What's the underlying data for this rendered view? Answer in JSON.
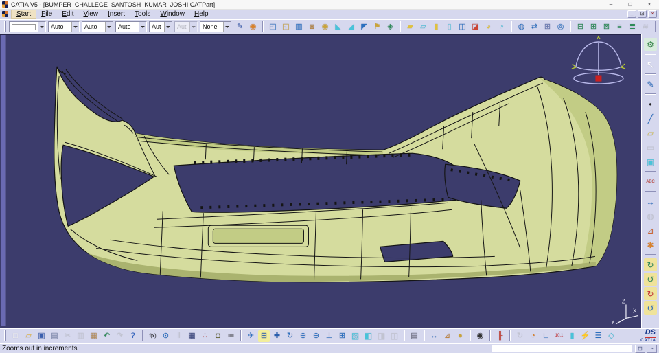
{
  "colors": {
    "vp-bg": "#3c3c6c",
    "model": "#d5dc9e",
    "model-dark": "#c2cc85",
    "model-darker": "#aab36f",
    "edge": "#151515",
    "strip": "#6a6ab2",
    "compass": "#b9b9ea",
    "ui": "#d6d8ee",
    "accent": "#2a6fbf"
  },
  "title_bar": {
    "title": "CATIA V5 - [BUMPER_CHALLEGE_SANTOSH_KUMAR_JOSHI.CATPart]",
    "controls": [
      {
        "name": "minimize-button",
        "glyph": "–",
        "color": "#333"
      },
      {
        "name": "maximize-button",
        "glyph": "□",
        "color": "#333"
      },
      {
        "name": "close-button",
        "glyph": "×",
        "color": "#333"
      }
    ]
  },
  "menu_bar": {
    "items": [
      "Start",
      "File",
      "Edit",
      "View",
      "Insert",
      "Tools",
      "Window",
      "Help"
    ],
    "controls": [
      {
        "name": "mdi-minimize-button",
        "glyph": "_",
        "color": "#333"
      },
      {
        "name": "mdi-restore-button",
        "glyph": "⊡",
        "color": "#333"
      },
      {
        "name": "mdi-close-button",
        "glyph": "×",
        "color": "#a03030"
      }
    ]
  },
  "top_toolbar": {
    "combos": [
      {
        "name": "layer-combo",
        "swatch": true,
        "w": 54
      },
      {
        "name": "color-combo",
        "value": "Auto",
        "w": 46
      },
      {
        "name": "linetype-combo",
        "value": "Auto",
        "w": 46
      },
      {
        "name": "thickness-combo",
        "value": "Auto",
        "w": 46
      },
      {
        "name": "symbol-combo",
        "value": "Aut",
        "w": 34
      },
      {
        "name": "render-combo",
        "value": "Aut",
        "w": 34,
        "disabled": true
      },
      {
        "name": "layer-filter-combo",
        "value": "None",
        "w": 46
      }
    ],
    "icons": [
      {
        "name": "painter-icon",
        "glyph": "✎",
        "color": "#3a5fae"
      },
      {
        "name": "graphic-wizard-icon",
        "glyph": "◉",
        "color": "#d9822b"
      },
      {
        "sep": true
      },
      {
        "name": "open-body-icon",
        "glyph": "◰",
        "color": "#2a6fbf"
      },
      {
        "name": "insert-body-icon",
        "glyph": "◱",
        "color": "#caa43a"
      },
      {
        "name": "translate-icon",
        "glyph": "▥",
        "color": "#2a6fbf"
      },
      {
        "name": "rotate-body-icon",
        "glyph": "◙",
        "color": "#b5884a"
      },
      {
        "name": "symmetry-icon",
        "glyph": "◉",
        "color": "#caa43a"
      },
      {
        "name": "scaling-icon",
        "glyph": "◣",
        "color": "#49c3d9"
      },
      {
        "name": "mirror-icon",
        "glyph": "◢",
        "color": "#49c3d9"
      },
      {
        "name": "pattern-icon",
        "glyph": "◤",
        "color": "#2a6fbf"
      },
      {
        "name": "flag-note-icon",
        "glyph": "⚑",
        "color": "#caa43a"
      },
      {
        "name": "thick-surface-icon",
        "glyph": "◈",
        "color": "#2e8b57"
      },
      {
        "sep": true
      },
      {
        "name": "pad-icon",
        "glyph": "▰",
        "color": "#e0c23e"
      },
      {
        "name": "pocket-icon",
        "glyph": "▱",
        "color": "#49c3d9"
      },
      {
        "name": "shaft-icon",
        "glyph": "▮",
        "color": "#e0c23e"
      },
      {
        "name": "groove-icon",
        "glyph": "▯",
        "color": "#49c3d9"
      },
      {
        "name": "hole-icon",
        "glyph": "◫",
        "color": "#2a6fbf"
      },
      {
        "name": "rib-icon",
        "glyph": "◪",
        "color": "#cc4433"
      },
      {
        "name": "slot-icon",
        "glyph": "◕",
        "color": "#e0c23e"
      },
      {
        "name": "stiffener-icon",
        "glyph": "◔",
        "color": "#49c3d9"
      },
      {
        "sep": true
      },
      {
        "name": "sew-surface-icon",
        "glyph": "◍",
        "color": "#2a6fbf"
      },
      {
        "name": "split-icon",
        "glyph": "⇄",
        "color": "#2a6fbf"
      },
      {
        "name": "work-grid-icon",
        "glyph": "⊞",
        "color": "#6a7ab0"
      },
      {
        "name": "light-source-icon",
        "glyph": "◎",
        "color": "#2a6fbf"
      },
      {
        "sep": true
      },
      {
        "name": "constraint-icon",
        "glyph": "⊟",
        "color": "#2e8b57"
      },
      {
        "name": "contact-constraint-icon",
        "glyph": "⊞",
        "color": "#2e8b57"
      },
      {
        "name": "fix-constraint-icon",
        "glyph": "⊠",
        "color": "#2e8b57"
      },
      {
        "name": "coincidence-icon",
        "glyph": "≡",
        "color": "#2e8b57"
      },
      {
        "name": "offset-constraint-icon",
        "glyph": "≣",
        "color": "#2e8b57"
      },
      {
        "name": "auto-constraint-icon",
        "glyph": "≋",
        "color": "#9aa",
        "disabled": true
      },
      {
        "sep": true
      },
      {
        "name": "eraser-icon",
        "glyph": "◆",
        "color": "#49a9d9"
      }
    ]
  },
  "right_toolbar": {
    "icons": [
      {
        "name": "workbench-icon",
        "glyph": "⚙",
        "color": "#3f8f4f",
        "bg": "#d9ecdd"
      },
      {
        "sep": true
      },
      {
        "name": "select-icon",
        "glyph": "↖",
        "color": "#ffffff",
        "fs": 14
      },
      {
        "sep": true
      },
      {
        "name": "sketcher-icon",
        "glyph": "✎",
        "color": "#2a6fbf"
      },
      {
        "sep": true
      },
      {
        "name": "point-icon",
        "glyph": "•",
        "color": "#222"
      },
      {
        "name": "line-icon",
        "glyph": "╱",
        "color": "#2a6fbf"
      },
      {
        "name": "plane-icon",
        "glyph": "▱",
        "color": "#d8c23a"
      },
      {
        "name": "positioned-sketch-icon",
        "glyph": "▭",
        "color": "#9aa",
        "disabled": true
      },
      {
        "name": "bounding-box-icon",
        "glyph": "▣",
        "color": "#49c3d9"
      },
      {
        "sep": true
      },
      {
        "name": "annotation-icon",
        "glyph": "ABC",
        "color": "#c0392b",
        "fs": 6
      },
      {
        "sep": true
      },
      {
        "name": "measure-icon",
        "glyph": "↔",
        "color": "#2a6fbf"
      },
      {
        "name": "apply-material-icon",
        "glyph": "◍",
        "color": "#9aa",
        "disabled": true
      },
      {
        "name": "measure-item-icon",
        "glyph": "⊿",
        "color": "#cc6633"
      },
      {
        "name": "graphic-properties-icon",
        "glyph": "✱",
        "color": "#d9822b"
      },
      {
        "sep": true
      },
      {
        "name": "catalog-browser-icon",
        "glyph": "↻",
        "color": "#2e8b57",
        "bg": "#efe39a"
      },
      {
        "name": "catalog-update-icon",
        "glyph": "↺",
        "color": "#2e8b57",
        "bg": "#efe39a"
      },
      {
        "name": "catalog-sync-icon",
        "glyph": "↻",
        "color": "#cc3333",
        "bg": "#efe39a"
      },
      {
        "name": "catalog-instantiate-icon",
        "glyph": "↺",
        "color": "#2a6fbf",
        "bg": "#efe39a"
      }
    ]
  },
  "bottom_toolbar": {
    "icons": [
      {
        "name": "new-document-icon",
        "glyph": "□",
        "color": "#fffef2"
      },
      {
        "name": "open-icon",
        "glyph": "▱",
        "color": "#e8b93e"
      },
      {
        "name": "save-icon",
        "glyph": "▣",
        "color": "#3a5fae"
      },
      {
        "name": "print-icon",
        "glyph": "▤",
        "color": "#7a86a8"
      },
      {
        "name": "cut-icon",
        "glyph": "✂",
        "color": "#9aa",
        "disabled": true
      },
      {
        "name": "copy-icon",
        "glyph": "▥",
        "color": "#9aa",
        "disabled": true
      },
      {
        "name": "paste-icon",
        "glyph": "▦",
        "color": "#b5884a"
      },
      {
        "name": "undo-icon",
        "glyph": "↶",
        "color": "#2e8b57"
      },
      {
        "name": "redo-icon",
        "glyph": "↷",
        "color": "#9aa",
        "disabled": true
      },
      {
        "name": "whats-this-icon",
        "glyph": "?",
        "color": "#2a5fbf"
      },
      {
        "sep": true
      },
      {
        "name": "formula-icon",
        "glyph": "f(x)",
        "color": "#222",
        "fs": 7
      },
      {
        "name": "comment-icon",
        "glyph": "⊙",
        "color": "#2a6fbf"
      },
      {
        "name": "knowledge-expert-icon",
        "glyph": "‖",
        "color": "#9aa",
        "disabled": true
      },
      {
        "name": "design-table-icon",
        "glyph": "▦",
        "color": "#39457a"
      },
      {
        "name": "relations-icon",
        "glyph": "∴",
        "color": "#c0392b"
      },
      {
        "name": "lock-icon",
        "glyph": "◘",
        "color": "#6a6a3a"
      },
      {
        "name": "check-icon",
        "glyph": "≔",
        "color": "#444",
        "fs": 10
      },
      {
        "sep": true
      },
      {
        "name": "fly-mode-icon",
        "glyph": "✈",
        "color": "#2a6fbf"
      },
      {
        "name": "fit-all-in-icon",
        "glyph": "⊞",
        "color": "#2a5fae",
        "bg": "#f2ee9c"
      },
      {
        "name": "pan-icon",
        "glyph": "✚",
        "color": "#2a5fae"
      },
      {
        "name": "rotate-icon",
        "glyph": "↻",
        "color": "#2a6fbf"
      },
      {
        "name": "zoom-in-icon",
        "glyph": "⊕",
        "color": "#2a6fbf"
      },
      {
        "name": "zoom-out-icon",
        "glyph": "⊖",
        "color": "#2a6fbf"
      },
      {
        "name": "normal-view-icon",
        "glyph": "⊥",
        "color": "#2a6fbf"
      },
      {
        "name": "multi-view-icon",
        "glyph": "⊞",
        "color": "#2a6fbf"
      },
      {
        "name": "iso-view-icon",
        "glyph": "▧",
        "color": "#49c3d9",
        "fs": 12
      },
      {
        "name": "render-style-icon",
        "glyph": "◧",
        "color": "#49c3d9",
        "fs": 12
      },
      {
        "name": "hidden-line-icon",
        "glyph": "◨",
        "color": "#9aa",
        "disabled": true,
        "fs": 12
      },
      {
        "name": "wireframe-icon",
        "glyph": "◫",
        "color": "#9aa",
        "disabled": true,
        "fs": 12
      },
      {
        "sep": true
      },
      {
        "name": "render-tools-icon",
        "glyph": "▤",
        "color": "#667"
      },
      {
        "sep": true
      },
      {
        "name": "measure-between-icon",
        "glyph": "↔",
        "color": "#2a6fbf"
      },
      {
        "name": "measure-item-icon",
        "glyph": "⊿",
        "color": "#c08033"
      },
      {
        "name": "measure-inertia-icon",
        "glyph": "●",
        "color": "#caa43a"
      },
      {
        "sep": true
      },
      {
        "name": "capture-icon",
        "glyph": "◉",
        "color": "#333"
      },
      {
        "sep": true
      },
      {
        "name": "ruler-icon",
        "glyph": "╟",
        "color": "#c0392b"
      },
      {
        "sep": true
      },
      {
        "name": "update-icon",
        "glyph": "↻",
        "color": "#9aa",
        "disabled": true
      },
      {
        "name": "knowledge-inspector-icon",
        "glyph": "◔",
        "color": "#d9822b"
      },
      {
        "name": "axis-system-icon",
        "glyph": "∟",
        "color": "#2a6fbf"
      },
      {
        "name": "mean-dimensions-icon",
        "glyph": "10.1",
        "color": "#cc3333",
        "fs": 6
      },
      {
        "name": "only-current-body-icon",
        "glyph": "▮",
        "color": "#49c3d9"
      },
      {
        "name": "catalyst-icon",
        "glyph": "⚡",
        "color": "#cc8a2a"
      },
      {
        "name": "sections-icon",
        "glyph": "☰",
        "color": "#2a6fbf"
      },
      {
        "name": "create-datum-icon",
        "glyph": "◇",
        "color": "#49c3d9"
      }
    ]
  },
  "status_bar": {
    "message": "Zooms out in increments",
    "buttons": [
      {
        "name": "command-history-button",
        "glyph": "⊡",
        "color": "#55608a"
      },
      {
        "name": "power-input-button",
        "glyph": "◔",
        "color": "#55608a"
      }
    ]
  },
  "viewport": {
    "axis": {
      "z": "Z",
      "x": "X",
      "y": "y"
    }
  },
  "brand": {
    "ds": "DS",
    "name": "CATIA"
  }
}
